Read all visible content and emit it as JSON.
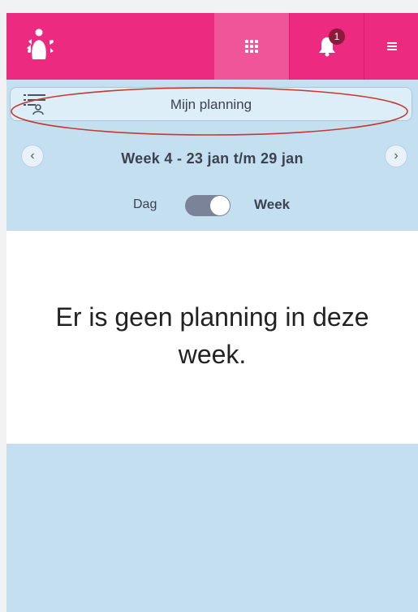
{
  "topbar": {
    "background": "#ec2a7f",
    "logo_icon": "people-network-logo-icon",
    "grid_icon": "app-grid-icon",
    "bell_icon": "bell-icon",
    "notification_count": "1",
    "menu_icon": "hamburger-menu-icon"
  },
  "filter": {
    "icon": "filter-list-icon",
    "label": "Mijn planning"
  },
  "week_nav": {
    "prev_icon": "chevron-left-icon",
    "next_icon": "chevron-right-icon",
    "label": "Week 4 - 23 jan t/m 29 jan"
  },
  "view_toggle": {
    "day_label": "Dag",
    "week_label": "Week",
    "selected": "Week"
  },
  "main": {
    "empty_message": "Er is geen planning in deze week."
  }
}
